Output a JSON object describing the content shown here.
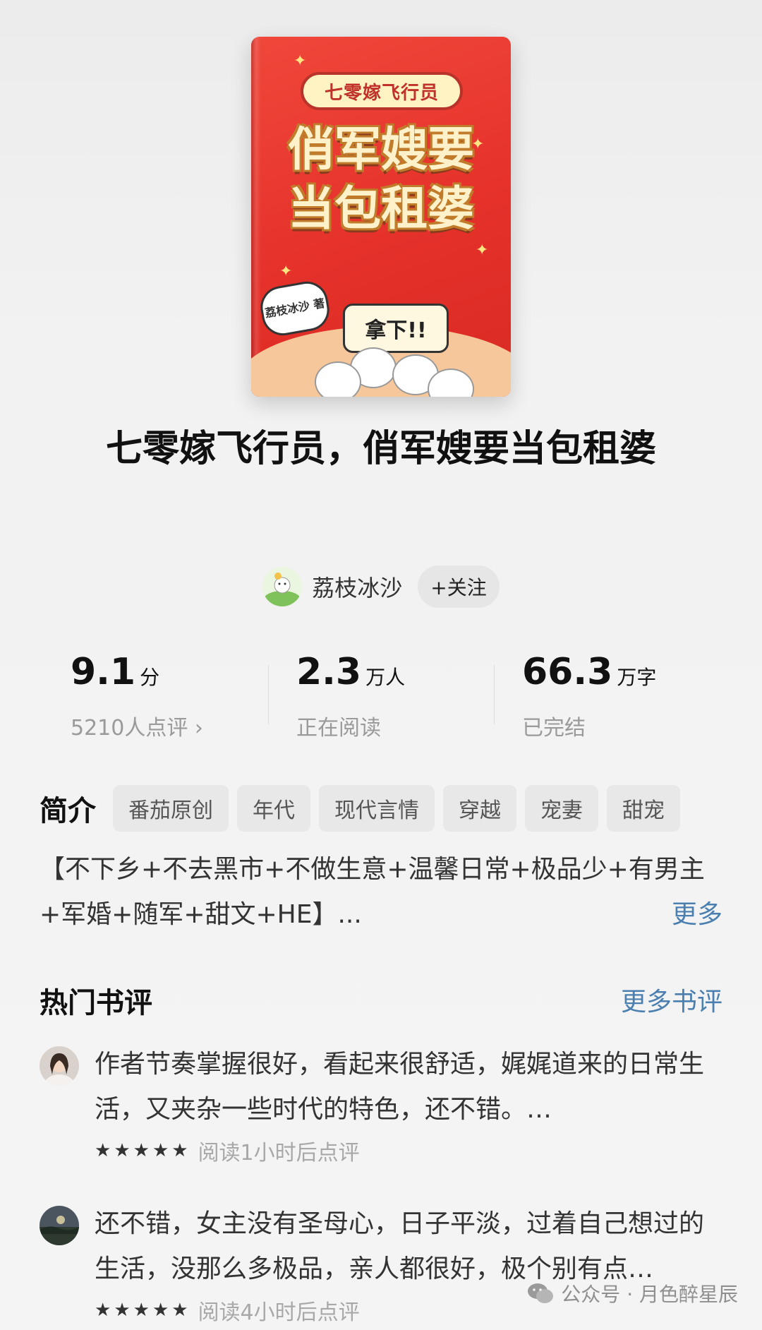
{
  "cover": {
    "small_title": "七零嫁飞行员",
    "big_title_line1": "俏军嫂要",
    "big_title_line2": "当包租婆",
    "author_tag": "荔枝冰沙 著",
    "bubble_text": "拿下!!"
  },
  "book": {
    "title": "七零嫁飞行员，俏军嫂要当包租婆"
  },
  "author": {
    "name": "荔枝冰沙",
    "follow_label": "+关注"
  },
  "stats": [
    {
      "value": "9.1",
      "unit": "分",
      "sub": "5210人点评 ›"
    },
    {
      "value": "2.3",
      "unit": "万人",
      "sub": "正在阅读"
    },
    {
      "value": "66.3",
      "unit": "万字",
      "sub": "已完结"
    }
  ],
  "intro": {
    "heading": "简介",
    "tags": [
      "番茄原创",
      "年代",
      "现代言情",
      "穿越",
      "宠妻",
      "甜宠"
    ],
    "text": "【不下乡+不去黑市+不做生意+温馨日常+极品少+有男主+军婚+随军+甜文+HE】...",
    "more_label": "更多"
  },
  "reviews": {
    "heading": "热门书评",
    "more_label": "更多书评",
    "items": [
      {
        "text": "作者节奏掌握很好，看起来很舒适，娓娓道来的日常生活，又夹杂一些时代的特色，还不错。…",
        "rating": 5,
        "time": "阅读1小时后点评"
      },
      {
        "text": "还不错，女主没有圣母心，日子平淡，过着自己想过的生活，没那么多极品，亲人都很好，极个别有点…",
        "rating": 5,
        "time": "阅读4小时后点评"
      }
    ]
  },
  "watermark": {
    "text": "公众号 · 月色醉星辰"
  }
}
